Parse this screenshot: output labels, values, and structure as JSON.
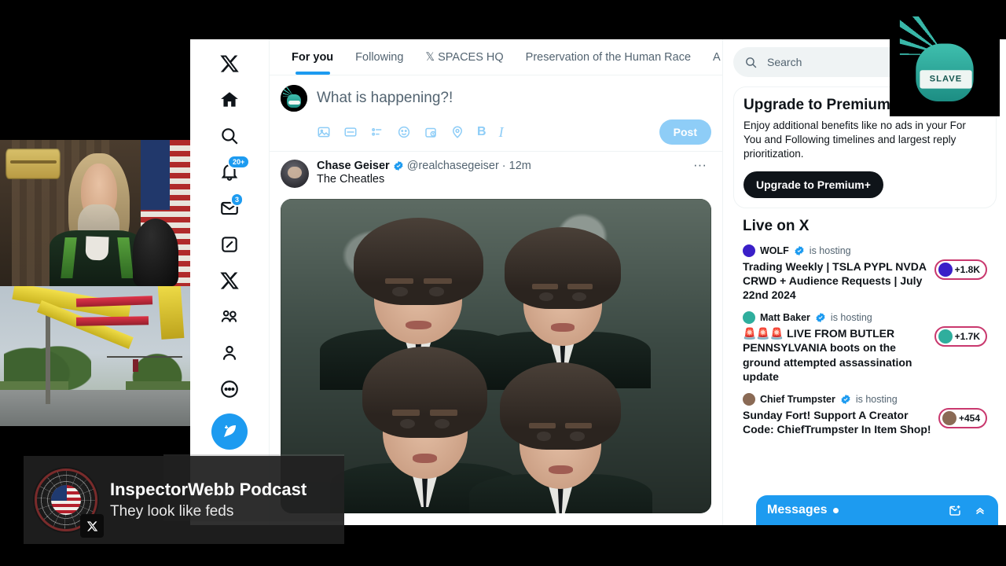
{
  "app": {
    "name": "X"
  },
  "sidebar": {
    "items": [
      {
        "name": "x-logo",
        "label": "X"
      },
      {
        "name": "home",
        "label": "Home"
      },
      {
        "name": "explore",
        "label": "Explore"
      },
      {
        "name": "notifications",
        "label": "Notifications",
        "badge": "20+"
      },
      {
        "name": "messages",
        "label": "Messages",
        "badge": "3"
      },
      {
        "name": "grok",
        "label": "Grok"
      },
      {
        "name": "premium",
        "label": "Premium"
      },
      {
        "name": "communities",
        "label": "Communities"
      },
      {
        "name": "profile",
        "label": "Profile"
      },
      {
        "name": "more",
        "label": "More"
      }
    ],
    "compose_label": "Post"
  },
  "tabs": [
    {
      "label": "For you",
      "active": true
    },
    {
      "label": "Following",
      "active": false
    },
    {
      "label": "𝕏 SPACES HQ",
      "active": false
    },
    {
      "label": "Preservation of the Human Race",
      "active": false
    },
    {
      "label": "A",
      "active": false
    }
  ],
  "composer": {
    "placeholder": "What is happening?!",
    "post_button": "Post",
    "tools": [
      "image-icon",
      "gif-icon",
      "poll-icon",
      "emoji-icon",
      "schedule-icon",
      "location-icon",
      "bold-icon",
      "italic-icon"
    ]
  },
  "post": {
    "author": "Chase Geiser",
    "handle": "@realchasegeiser",
    "time": "12m",
    "verified": true,
    "text": "The Cheatles",
    "more": "···",
    "media_description": "Four people with mop-top haircuts in dark suits and ties, black-and-white toned group photo"
  },
  "search": {
    "placeholder": "Search"
  },
  "premium": {
    "title": "Upgrade to Premium+",
    "body": "Enjoy additional benefits like no ads in your For You and Following timelines and largest reply prioritization.",
    "button": "Upgrade to Premium+"
  },
  "live_on_x": {
    "heading": "Live on X",
    "hosting_suffix": "is hosting",
    "items": [
      {
        "host": "WOLF",
        "verified": true,
        "title": "Trading Weekly | TSLA PYPL NVDA CRWD + Audience Requests | July 22nd 2024",
        "listeners": "+1.8K",
        "host_avatar_color": "#3a1fc8"
      },
      {
        "host": "Matt Baker",
        "verified": true,
        "title": "🚨🚨🚨 LIVE FROM BUTLER PENNSYLVANIA boots on the ground attempted assassination update",
        "listeners": "+1.7K",
        "host_avatar_color": "#2fae9d"
      },
      {
        "host": "Chief Trumpster",
        "verified": true,
        "title": "Sunday Fort! Support A Creator Code: ChiefTrumpster In Item Shop!",
        "listeners": "+454",
        "host_avatar_color": "#8a6a55"
      }
    ]
  },
  "messages_dock": {
    "label": "Messages",
    "has_unread": true,
    "icons": [
      "new-message-icon",
      "chevron-up-icon"
    ]
  },
  "lower_third": {
    "title": "InspectorWebb Podcast",
    "subtitle": "They look like feds",
    "platform_icon": "x-icon",
    "logo_description": "Circular spider-web badge with American flag center"
  },
  "overlays": {
    "liberty_badge": "Teal Statue of Liberty head wearing a mask labeled SLAVE",
    "liberty_mask_text": "SLAVE"
  },
  "videos": {
    "host_cam": "Man with long hair and beard in green jacket, American flag and We The People sign behind",
    "street_cam": "Street view with yellow and red crane boom overhead and traffic signals"
  },
  "colors": {
    "accent": "#1d9bf0",
    "text": "#0f1419",
    "muted": "#536471",
    "pill_border": "#c9386e",
    "dark_button": "#0f1419",
    "liberty_teal": "#2fae9d"
  }
}
